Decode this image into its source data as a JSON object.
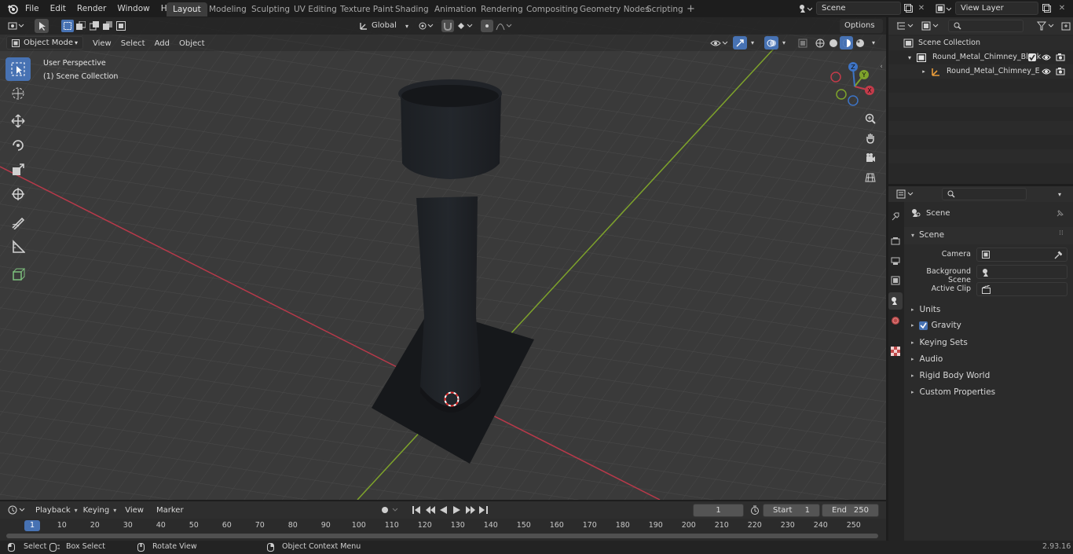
{
  "topbar": {
    "menus": [
      "File",
      "Edit",
      "Render",
      "Window",
      "Help"
    ],
    "workspaces": [
      "Layout",
      "Modeling",
      "Sculpting",
      "UV Editing",
      "Texture Paint",
      "Shading",
      "Animation",
      "Rendering",
      "Compositing",
      "Geometry Nodes",
      "Scripting"
    ],
    "active_workspace": "Layout",
    "add_tab": "+",
    "scene_name": "Scene",
    "view_layer_name": "View Layer"
  },
  "viewport": {
    "mode": "Object Mode",
    "menus": [
      "View",
      "Select",
      "Add",
      "Object"
    ],
    "transform_orientation": "Global",
    "options_label": "Options",
    "overlay_text_1": "User Perspective",
    "overlay_text_2": "(1) Scene Collection",
    "gizmo_labels": {
      "x": "X",
      "y": "Y",
      "z": "Z"
    }
  },
  "outliner": {
    "search_placeholder": "",
    "root": "Scene Collection",
    "items": [
      {
        "label": "Round_Metal_Chimney_Black"
      },
      {
        "label": "Round_Metal_Chimney_E"
      }
    ]
  },
  "properties": {
    "context_title": "Scene",
    "panel_title": "Scene",
    "fields": [
      {
        "label": "Camera",
        "value": ""
      },
      {
        "label": "Background Scene",
        "value": ""
      },
      {
        "label": "Active Clip",
        "value": ""
      }
    ],
    "panels": [
      "Units",
      "Gravity",
      "Keying Sets",
      "Audio",
      "Rigid Body World",
      "Custom Properties"
    ],
    "gravity_checked": true
  },
  "timeline": {
    "menus": [
      "Playback",
      "Keying",
      "View",
      "Marker"
    ],
    "current_frame": "1",
    "start_label": "Start",
    "start_value": "1",
    "end_label": "End",
    "end_value": "250",
    "ruler": [
      "1",
      "10",
      "20",
      "30",
      "40",
      "50",
      "60",
      "70",
      "80",
      "90",
      "100",
      "110",
      "120",
      "130",
      "140",
      "150",
      "160",
      "170",
      "180",
      "190",
      "200",
      "210",
      "220",
      "230",
      "240",
      "250"
    ]
  },
  "status": {
    "select": "Select",
    "box_select": "Box Select",
    "rotate_view": "Rotate View",
    "context_menu": "Object Context Menu",
    "version": "2.93.16"
  },
  "colors": {
    "accent": "#4772b3",
    "x_axis": "#b8394a",
    "y_axis": "#7ea32b",
    "viewport_bg": "#3d3d3d"
  }
}
